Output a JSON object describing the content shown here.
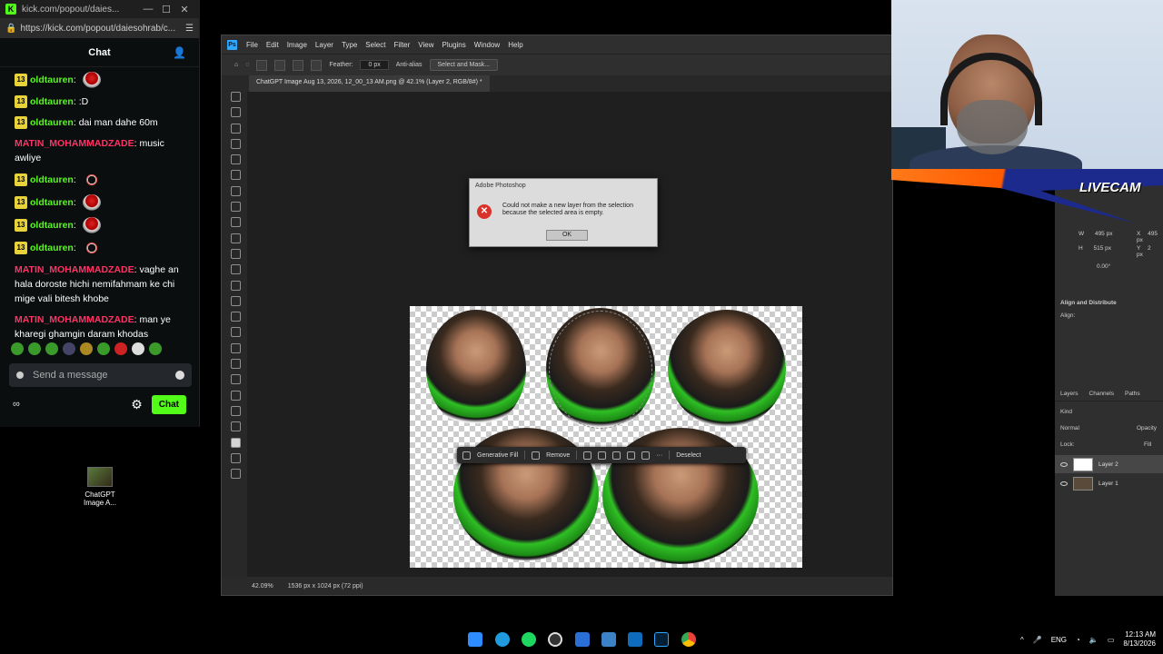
{
  "chat_window": {
    "title": "kick.com/popout/daies...",
    "url": "https://kick.com/popout/daiesohrab/c...",
    "header": "Chat",
    "messages": [
      {
        "badge": "13",
        "user": "oldtauren",
        "color": "green",
        "text": "",
        "emote": "red"
      },
      {
        "badge": "13",
        "user": "oldtauren",
        "color": "green",
        "text": ":D",
        "emote": ""
      },
      {
        "badge": "13",
        "user": "oldtauren",
        "color": "green",
        "text": "dai man dahe 60m",
        "emote": ""
      },
      {
        "badge": "",
        "user": "MATIN_MOHAMMADZADE",
        "color": "red",
        "text": "music awliye",
        "emote": ""
      },
      {
        "badge": "13",
        "user": "oldtauren",
        "color": "green",
        "text": "",
        "emote": "ring"
      },
      {
        "badge": "13",
        "user": "oldtauren",
        "color": "green",
        "text": "",
        "emote": "red"
      },
      {
        "badge": "13",
        "user": "oldtauren",
        "color": "green",
        "text": "",
        "emote": "red"
      },
      {
        "badge": "13",
        "user": "oldtauren",
        "color": "green",
        "text": "",
        "emote": "ring"
      },
      {
        "badge": "",
        "user": "MATIN_MOHAMMADZADE",
        "color": "red",
        "text": "vaghe an hala doroste hichi nemifahmam ke chi mige vali bitesh khobe",
        "emote": ""
      },
      {
        "badge": "",
        "user": "MATIN_MOHAMMADZADE",
        "color": "red",
        "text": "man ye kharegi ghamgin daram khodas",
        "emote": ""
      }
    ],
    "send_placeholder": "Send a message",
    "chat_button": "Chat",
    "infinity": "∞"
  },
  "desktop_icon": {
    "label": "ChatGPT Image A..."
  },
  "photoshop": {
    "logo": "Ps",
    "menu": [
      "File",
      "Edit",
      "Image",
      "Layer",
      "Type",
      "Select",
      "Filter",
      "View",
      "Plugins",
      "Window",
      "Help"
    ],
    "options": {
      "feather_label": "Feather:",
      "feather_value": "0 px",
      "antialias": "Anti-alias",
      "select_mask": "Select and Mask..."
    },
    "doc_tab": "ChatGPT Image Aug 13, 2026, 12_00_13 AM.png @ 42.1% (Layer 2, RGB/8#) *",
    "status_zoom": "42.09%",
    "status_info": "1536 px x 1024 px (72 ppi)",
    "gen_toolbar": {
      "generative_fill": "Generative Fill",
      "remove": "Remove",
      "deselect": "Deselect"
    },
    "dialog": {
      "title": "Adobe Photoshop",
      "message": "Could not make a new layer from the selection because the selected area is empty.",
      "ok": "OK"
    },
    "properties": {
      "w": "W",
      "w_val": "495 px",
      "h": "H",
      "h_val": "515 px",
      "x": "X",
      "x_val": "495 px",
      "y": "Y",
      "y_val": "2 px",
      "angle": "0.00°"
    },
    "align_title": "Align and Distribute",
    "align_label": "Align:",
    "layers_tabs": [
      "Layers",
      "Channels",
      "Paths"
    ],
    "kind": "Kind",
    "blend": "Normal",
    "opacity": "Opacity",
    "lock": "Lock:",
    "fill": "Fill",
    "layers": [
      "Layer 2",
      "Layer 1"
    ]
  },
  "webcam": {
    "overlay_text": "LIVECAM"
  },
  "taskbar": {
    "lang": "ENG",
    "time": "12:13 AM",
    "date": "8/13/2026"
  }
}
